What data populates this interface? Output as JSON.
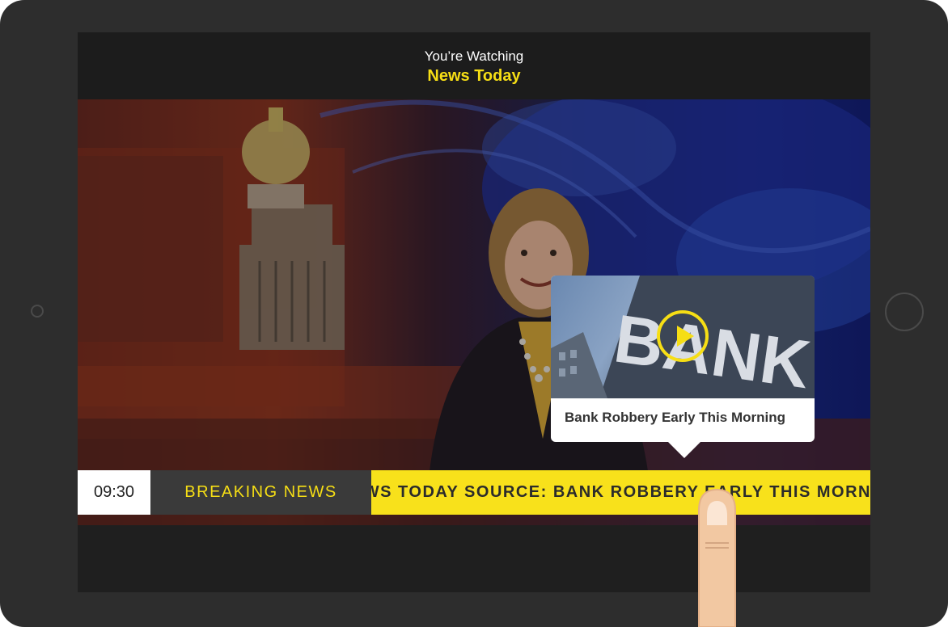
{
  "header": {
    "subtitle": "You’re Watching",
    "show_title": "News Today"
  },
  "ticker": {
    "time": "09:30",
    "label": "BREAKING NEWS",
    "scroll_text": "NEWS TODAY SOURCE: BANK ROBBERY EARLY THIS MORNING IN"
  },
  "popup": {
    "title": "Bank Robbery Early This Morning",
    "thumbnail_text": "BANK"
  },
  "colors": {
    "accent_yellow": "#f6de15",
    "ticker_yellow": "#f8e11b",
    "device_frame": "#2d2d2d",
    "screen_bg": "#1d1d1d"
  },
  "icons": {
    "play": "play-icon",
    "finger": "touch-finger-icon",
    "home": "home-button-icon",
    "camera": "camera-icon"
  }
}
